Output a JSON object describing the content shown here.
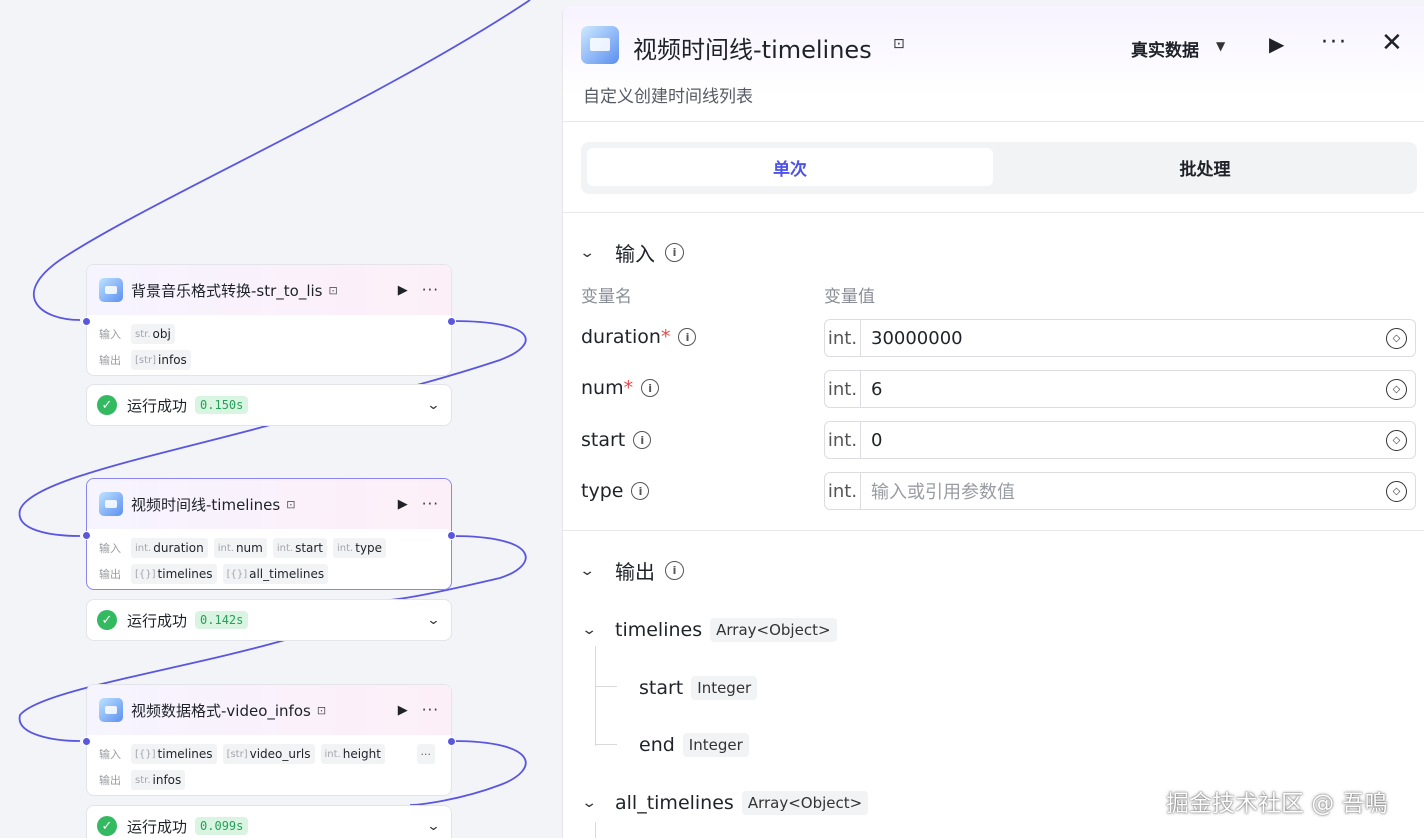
{
  "canvas": {
    "nodes": [
      {
        "title": "背景音乐格式转换-str_to_lis",
        "input_label": "输入",
        "output_label": "输出",
        "inputs": [
          {
            "type": "str.",
            "name": "obj"
          }
        ],
        "outputs": [
          {
            "type": "[str]",
            "name": "infos"
          }
        ],
        "status": "运行成功",
        "time": "0.150s"
      },
      {
        "title": "视频时间线-timelines",
        "input_label": "输入",
        "output_label": "输出",
        "inputs": [
          {
            "type": "int.",
            "name": "duration"
          },
          {
            "type": "int.",
            "name": "num"
          },
          {
            "type": "int.",
            "name": "start"
          },
          {
            "type": "int.",
            "name": "type"
          }
        ],
        "outputs": [
          {
            "type": "[{}]",
            "name": "timelines"
          },
          {
            "type": "[{}]",
            "name": "all_timelines"
          }
        ],
        "status": "运行成功",
        "time": "0.142s"
      },
      {
        "title": "视频数据格式-video_infos",
        "input_label": "输入",
        "output_label": "输出",
        "inputs": [
          {
            "type": "[{}]",
            "name": "timelines"
          },
          {
            "type": "[str]",
            "name": "video_urls"
          },
          {
            "type": "int.",
            "name": "height"
          }
        ],
        "more": "···",
        "outputs": [
          {
            "type": "str.",
            "name": "infos"
          }
        ],
        "status": "运行成功",
        "time": "0.099s"
      }
    ]
  },
  "panel": {
    "title": "视频时间线-timelines",
    "description": "自定义创建时间线列表",
    "mode": "真实数据",
    "tabs": [
      "单次",
      "批处理"
    ],
    "input_section": "输入",
    "col_name": "变量名",
    "col_value": "变量值",
    "params": [
      {
        "name": "duration",
        "required": true,
        "type": "int.",
        "value": "30000000"
      },
      {
        "name": "num",
        "required": true,
        "type": "int.",
        "value": "6"
      },
      {
        "name": "start",
        "required": false,
        "type": "int.",
        "value": "0"
      },
      {
        "name": "type",
        "required": false,
        "type": "int.",
        "value": "",
        "placeholder": "输入或引用参数值"
      }
    ],
    "output_section": "输出",
    "outputs": {
      "timelines": {
        "name": "timelines",
        "type": "Array<Object>"
      },
      "children": [
        {
          "name": "start",
          "type": "Integer"
        },
        {
          "name": "end",
          "type": "Integer"
        }
      ],
      "all_timelines": {
        "name": "all_timelines",
        "type": "Array<Object>"
      }
    }
  },
  "watermark": "掘金技术社区 @ 吾鳴",
  "colors": {
    "accent": "#4d53e8",
    "wire": "#5a56e0",
    "success": "#33b960"
  }
}
